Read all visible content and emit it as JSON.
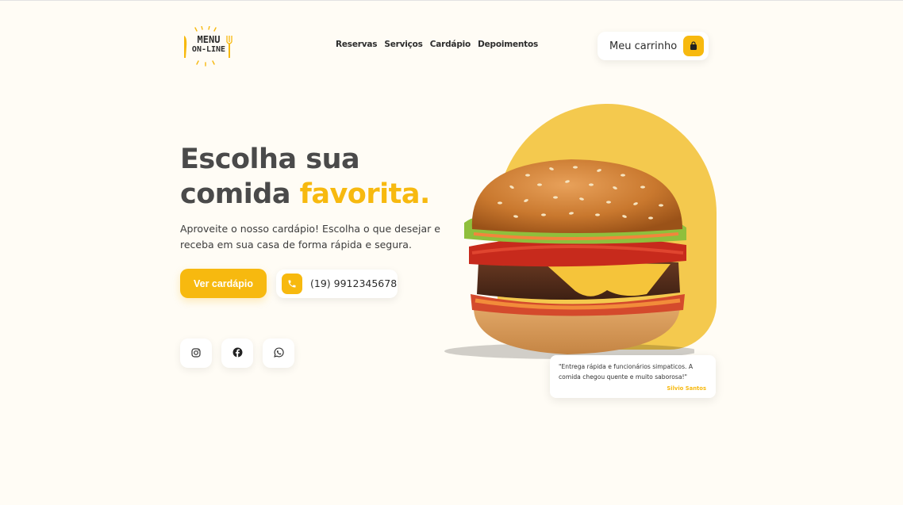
{
  "header": {
    "logo": {
      "line1": "MENU",
      "line2": "ON-LINE"
    },
    "nav": [
      {
        "label": "Reservas"
      },
      {
        "label": "Serviços"
      },
      {
        "label": "Cardápio"
      },
      {
        "label": "Depoimentos"
      }
    ],
    "cart": {
      "label": "Meu carrinho",
      "icon": "shopping-bag-icon"
    }
  },
  "hero": {
    "title_line1": "Escolha sua",
    "title_line2_plain": "comida ",
    "title_line2_accent": "favorita.",
    "subtitle": "Aproveite o nosso cardápio! Escolha o que desejar e receba em sua casa de forma rápida e segura.",
    "cta_label": "Ver cardápio",
    "phone": "(19) 9912345678",
    "social": [
      {
        "icon": "instagram-icon"
      },
      {
        "icon": "facebook-icon"
      },
      {
        "icon": "whatsapp-icon"
      }
    ]
  },
  "review": {
    "text": "\"Entrega rápida e funcionários simpaticos. A comida chegou quente e muito saborosa!\"",
    "author": "Silvio Santos"
  },
  "colors": {
    "accent": "#f7b90f",
    "background": "#fffcf5",
    "blob": "#f4c94e",
    "heading": "#4a4a4a"
  }
}
